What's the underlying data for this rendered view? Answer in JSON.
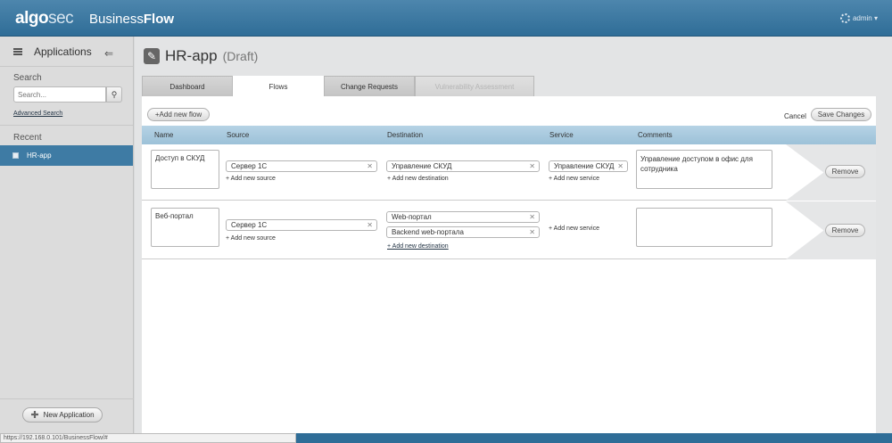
{
  "header": {
    "logo_a": "algo",
    "logo_b": "sec",
    "product_a": "Business",
    "product_b": "Flow",
    "user": "admin ▾"
  },
  "sidebar": {
    "title": "Applications",
    "search_label": "Search",
    "search_placeholder": "Search...",
    "advanced_search": "Advanced Search",
    "recent_label": "Recent",
    "recent_items": [
      "HR-app"
    ],
    "new_app_button": "New Application"
  },
  "page": {
    "title": "HR-app",
    "status": "(Draft)"
  },
  "tabs": [
    "Dashboard",
    "Flows",
    "Change Requests",
    "Vulnerability Assessment"
  ],
  "toolbar": {
    "add_flow": "+Add new flow",
    "cancel": "Cancel",
    "save": "Save Changes"
  },
  "columns": [
    "Name",
    "Source",
    "Destination",
    "Service",
    "Comments"
  ],
  "flows": [
    {
      "name": "Доступ в СКУД",
      "sources": [
        "Сервер 1С"
      ],
      "add_source": "+ Add new source",
      "destinations": [
        "Управление СКУД"
      ],
      "add_destination": "+ Add new destination",
      "services": [
        "Управление СКУД"
      ],
      "add_service": "+ Add new service",
      "comment": "Управление доступом в офис для сотрудника",
      "remove": "Remove"
    },
    {
      "name": "Веб-портал",
      "sources": [
        "Сервер 1С"
      ],
      "add_source": "+ Add new source",
      "destinations": [
        "Web-портал",
        "Backend web-портала"
      ],
      "add_destination": "+ Add new destination",
      "services": [],
      "add_service": "+ Add new service",
      "comment": "",
      "remove": "Remove"
    }
  ],
  "statusbar": {
    "url": "https://192.168.0.101/BusinessFlow/#"
  }
}
